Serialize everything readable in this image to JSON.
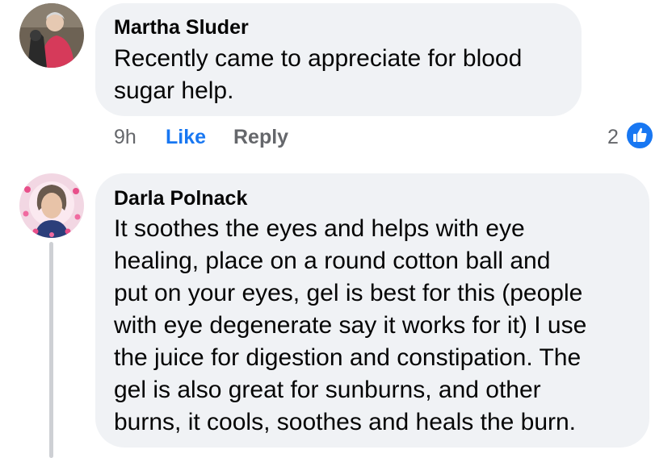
{
  "comments": [
    {
      "author": "Martha Sluder",
      "text": "Recently came to appreciate for blood\nsugar help.",
      "time": "9h",
      "like_label": "Like",
      "reply_label": "Reply",
      "reaction_count": "2",
      "reaction_icon": "thumbs-up-icon",
      "avatar_icon": "user-avatar"
    },
    {
      "author": "Darla Polnack",
      "text": "It soothes the eyes and helps with eye\nhealing, place on a round cotton ball and\nput on your eyes, gel is best for this (people\nwith eye degenerate say it works for it) I use\nthe juice for digestion and constipation. The\ngel is also great for sunburns, and other\nburns, it cools, soothes and heals the burn.",
      "avatar_icon": "user-avatar"
    }
  ],
  "colors": {
    "bubble": "#f0f2f5",
    "like": "#1877f2",
    "muted": "#65676b",
    "thread_line": "#ced0d4"
  }
}
